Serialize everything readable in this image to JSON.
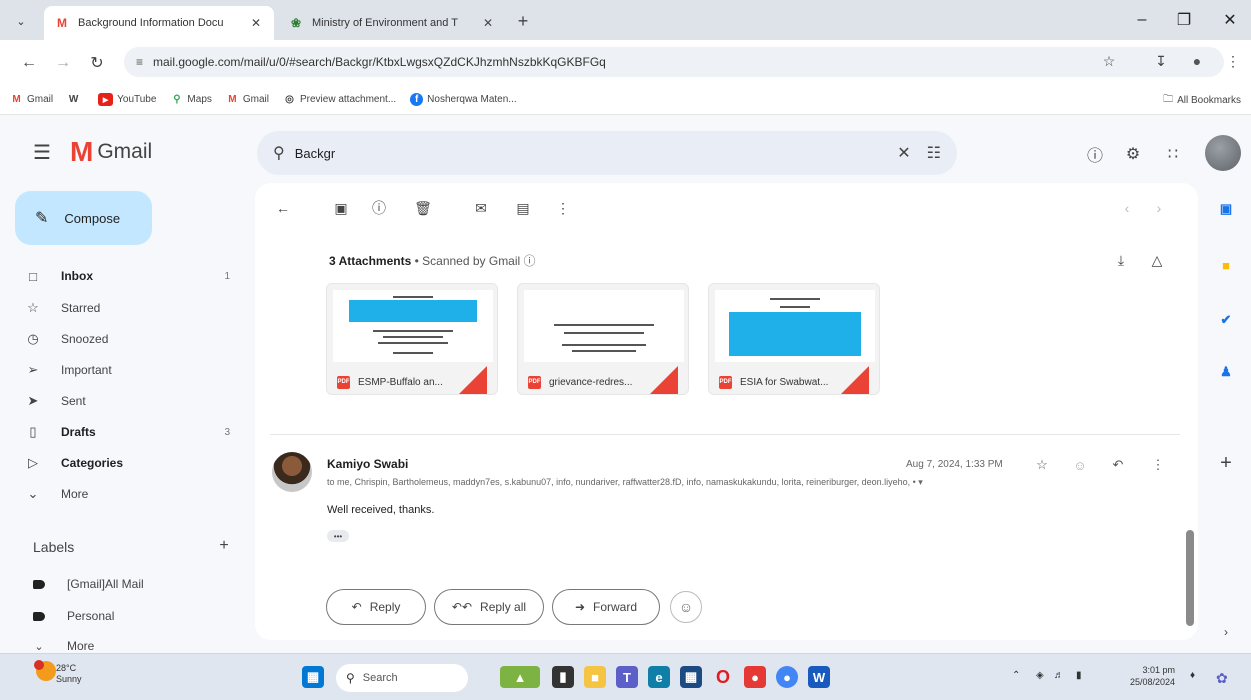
{
  "browser": {
    "tabs": [
      {
        "title": "Background Information Docu"
      },
      {
        "title": "Ministry of Environment and T"
      }
    ],
    "url": "mail.google.com/mail/u/0/#search/Backgr/KtbxLwgsxQZdCKJhzmhNszbkKqGKBFGq",
    "bookmarks": [
      "Gmail",
      "",
      "YouTube",
      "Maps",
      "Gmail",
      "Preview attachment...",
      "Nosherqwa Maten..."
    ],
    "all_bookmarks": "All Bookmarks"
  },
  "gmail": {
    "brand": "Gmail",
    "search_value": "Backgr",
    "compose": "Compose",
    "nav": [
      {
        "label": "Inbox",
        "count": "1",
        "bold": true
      },
      {
        "label": "Starred",
        "count": ""
      },
      {
        "label": "Snoozed",
        "count": ""
      },
      {
        "label": "Important",
        "count": ""
      },
      {
        "label": "Sent",
        "count": ""
      },
      {
        "label": "Drafts",
        "count": "3",
        "bold": true
      },
      {
        "label": "Categories",
        "count": "",
        "bold": true
      },
      {
        "label": "More",
        "count": ""
      }
    ],
    "labels_heading": "Labels",
    "labels": [
      "[Gmail]All Mail",
      "Personal",
      "More"
    ]
  },
  "attachments": {
    "heading": "3 Attachments",
    "scanned": "Scanned by Gmail",
    "files": [
      "ESMP-Buffalo an...",
      "grievance-redres...",
      "ESIA for Swabwat..."
    ]
  },
  "message": {
    "sender": "Kamiyo Swabi",
    "recipients": "to me, Chrispin, Bartholemeus, maddyn7es, s.kabunu07, info, nundariver, raffwatter28.fD, info, namaskukakundu, lorita, reineriburger, deon.liyeho, • ▾",
    "date": "Aug 7, 2024, 1:33 PM",
    "body": "Well received, thanks.",
    "dots": "•••"
  },
  "actions": {
    "reply": "Reply",
    "reply_all": "Reply all",
    "forward": "Forward"
  },
  "taskbar": {
    "temp": "28°C",
    "condition": "Sunny",
    "search": "Search",
    "time": "3:01 pm",
    "date": "25/08/2024"
  },
  "colors": {
    "compose_bg": "#c2e7ff",
    "gmail_red": "#ea4335",
    "blue_highlight": "#1fb0ea"
  }
}
